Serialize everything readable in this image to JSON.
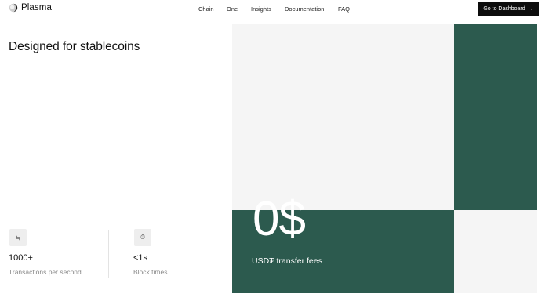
{
  "brand": {
    "name": "Plasma",
    "logo_icon": "plasma-logo-icon"
  },
  "nav": {
    "items": [
      "Chain",
      "One",
      "Insights",
      "Documentation",
      "FAQ"
    ],
    "cta_label": "Go to Dashboard",
    "cta_arrow": "→"
  },
  "hero": {
    "heading": "Designed for stablecoins"
  },
  "stats": [
    {
      "icon": "swap-arrows-icon",
      "glyph": "⇆",
      "value": "1000+",
      "label": "Transactions per second"
    },
    {
      "icon": "stopwatch-icon",
      "glyph": "⏱",
      "value": "<1s",
      "label": "Block times"
    }
  ],
  "fee_card": {
    "value": "0$",
    "label": "USD₮ transfer fees"
  },
  "colors": {
    "accent_green": "#2c5a4e",
    "light_gray": "#f5f5f5",
    "black": "#0d0d0d"
  }
}
